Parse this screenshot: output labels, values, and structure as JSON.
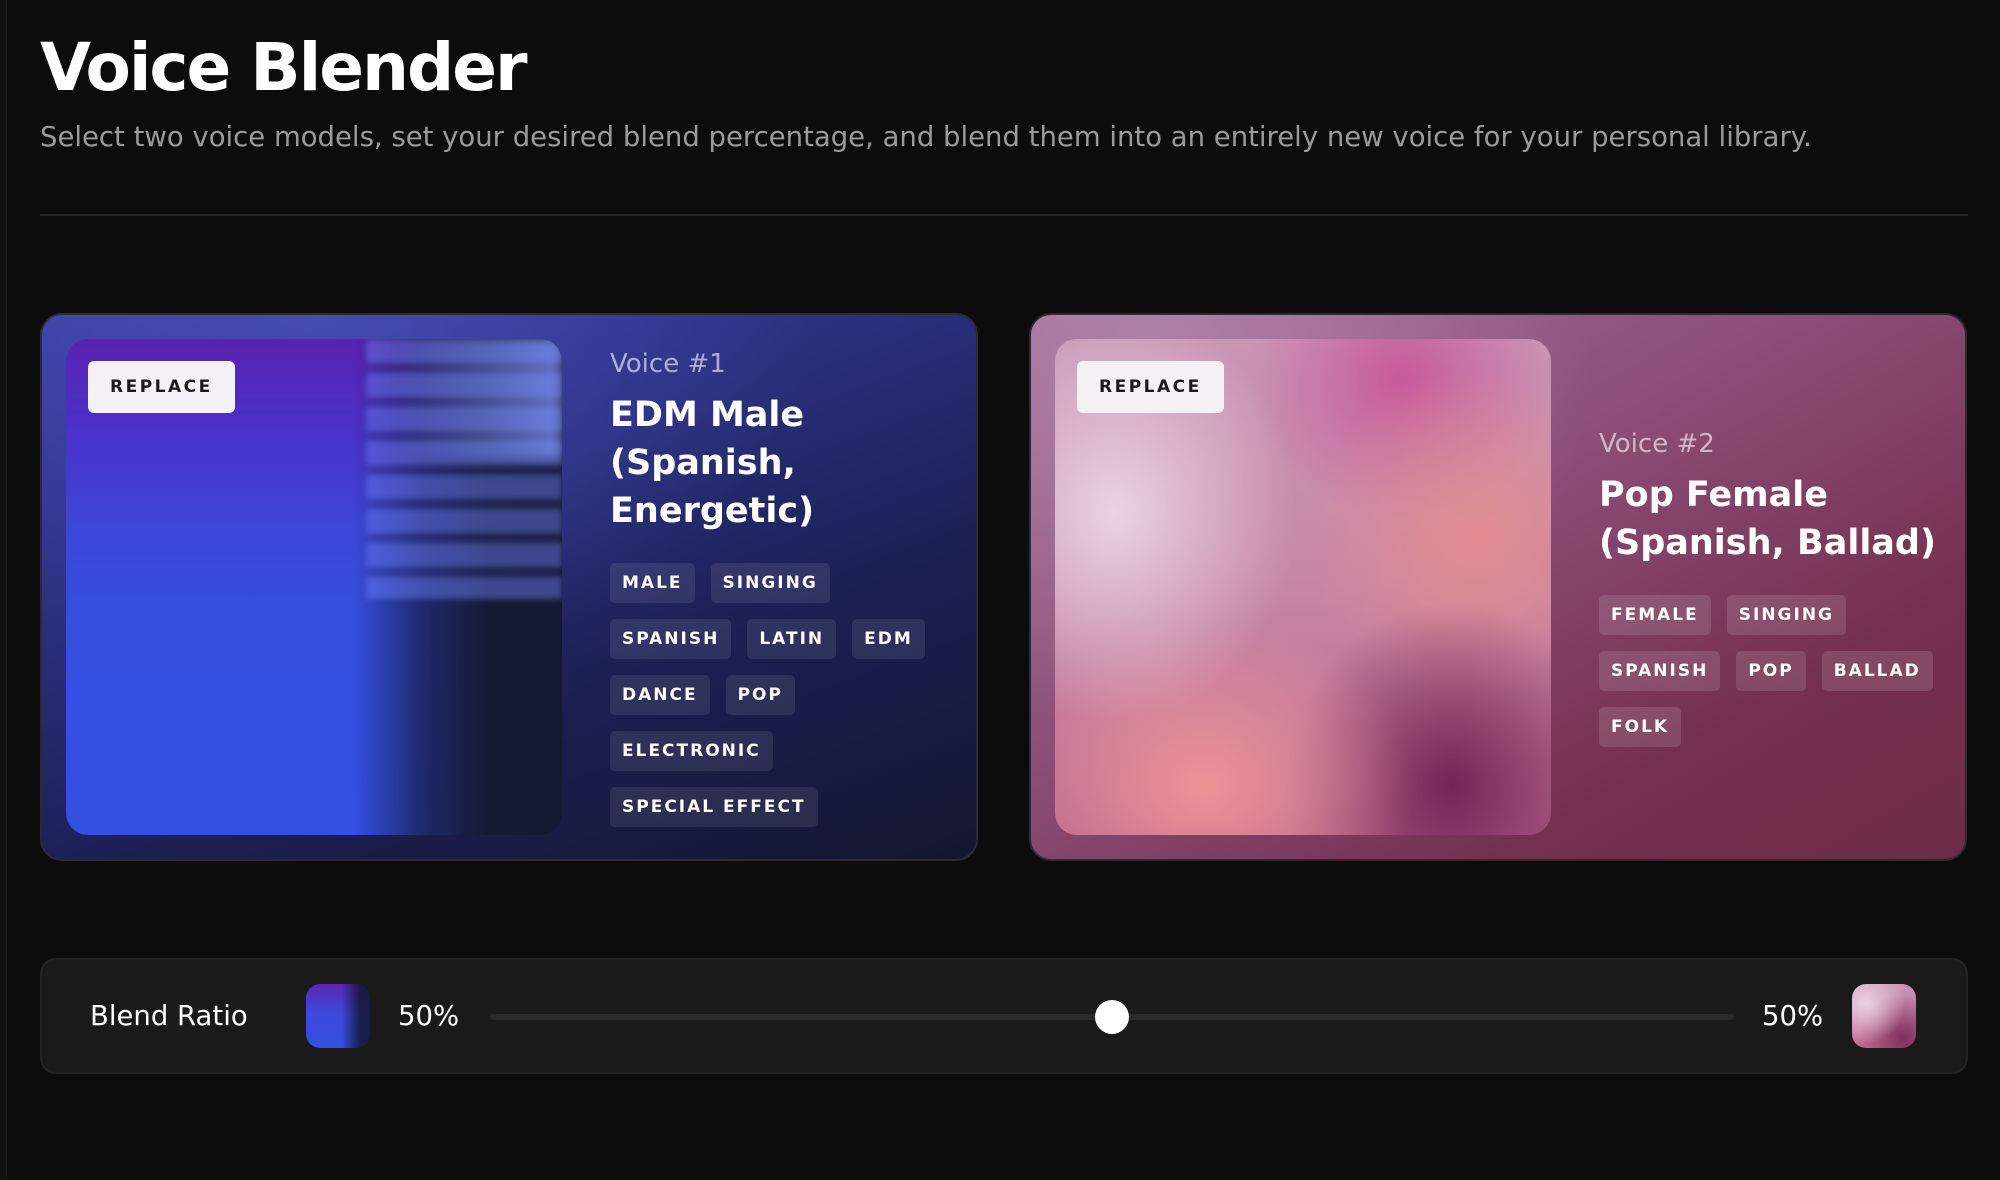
{
  "page": {
    "title": "Voice Blender",
    "subtitle": "Select two voice models, set your desired blend percentage, and blend them into an entirely new voice for your personal library."
  },
  "voices": [
    {
      "label": "Voice #1",
      "name": "EDM Male (Spanish, Energetic)",
      "replace_label": "REPLACE",
      "tags": [
        "MALE",
        "SINGING",
        "SPANISH",
        "LATIN",
        "EDM",
        "DANCE",
        "POP",
        "ELECTRONIC",
        "SPECIAL EFFECT"
      ],
      "accent_colors": [
        "#3b3fa2",
        "#3350e2",
        "#14162f"
      ]
    },
    {
      "label": "Voice #2",
      "name": "Pop Female (Spanish, Ballad)",
      "replace_label": "REPLACE",
      "tags": [
        "FEMALE",
        "SINGING",
        "SPANISH",
        "POP",
        "BALLAD",
        "FOLK"
      ],
      "accent_colors": [
        "#a16c93",
        "#c687a4",
        "#6c2c46"
      ]
    }
  ],
  "blend": {
    "label": "Blend Ratio",
    "left_percent_text": "50%",
    "right_percent_text": "50%",
    "slider_value": 0.5
  }
}
